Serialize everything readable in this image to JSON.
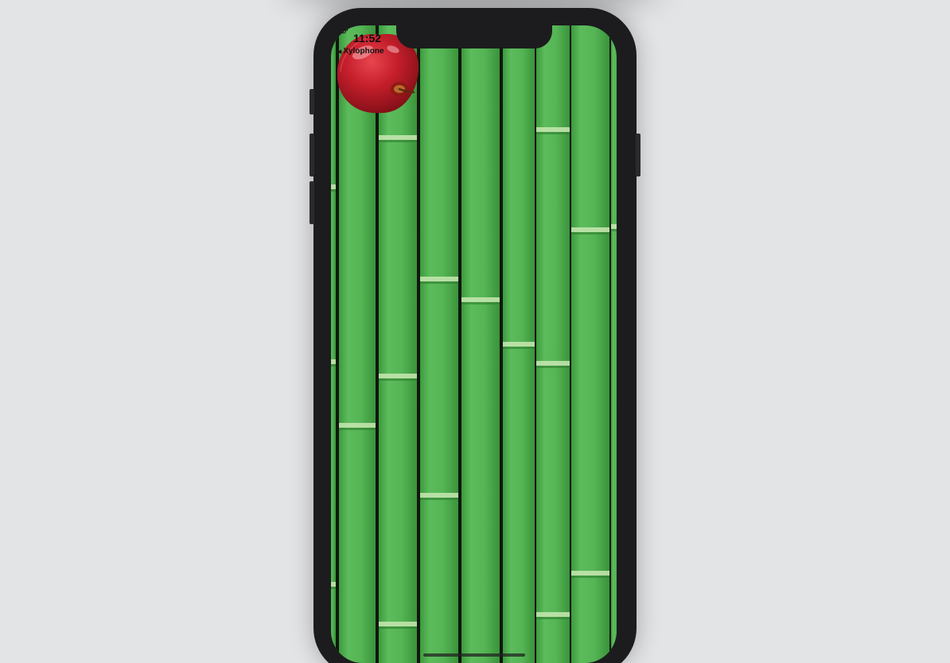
{
  "status_bar": {
    "time": "11:52",
    "back_app": "Xylophone",
    "wifi_icon": "wifi-icon",
    "battery_icon": "battery-icon"
  },
  "app": {
    "background": "bamboo-background",
    "center_image": "apple-image"
  },
  "colors": {
    "bamboo": "#4cae4c",
    "bamboo_light": "#63c263",
    "gap": "#10170f",
    "apple": "#c7202c",
    "desk": "#e3e4e6",
    "phone": "#1c1c1e"
  }
}
